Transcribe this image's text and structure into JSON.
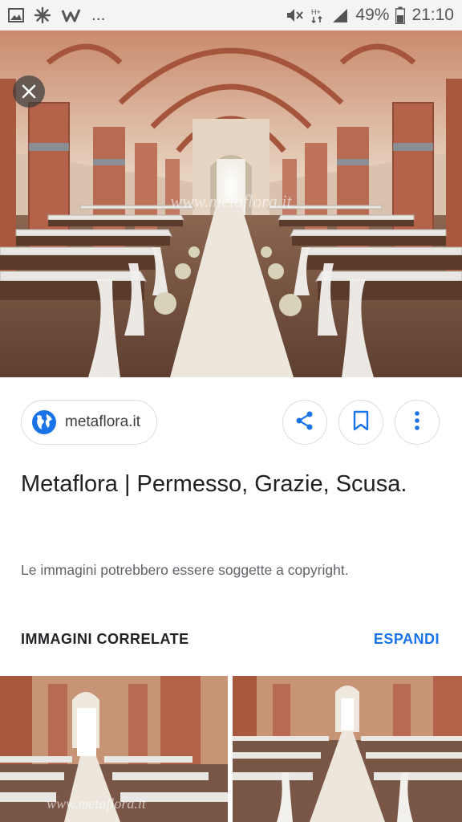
{
  "status_bar": {
    "battery": "49%",
    "time": "21:10",
    "overflow": "...",
    "icons": [
      "gallery-icon",
      "flower-icon",
      "w-app-icon",
      "mute-icon",
      "data-icon",
      "signal-icon",
      "battery-icon"
    ]
  },
  "image": {
    "watermark": "www.metaflora.it"
  },
  "source": {
    "label": "metaflora.it"
  },
  "actions": [
    "share-icon",
    "bookmark-icon",
    "more-vert-icon"
  ],
  "title": "Metaflora | Permesso, Grazie, Scusa.",
  "copyright": "Le immagini potrebbero essere soggette a copyright.",
  "related": {
    "header": "IMMAGINI CORRELATE",
    "expand": "ESPANDI",
    "thumb_watermark": "www.metaflora.it"
  },
  "colors": {
    "accent": "#1a73e8",
    "brick": "#b0604a",
    "runner": "#e8e2d8"
  }
}
